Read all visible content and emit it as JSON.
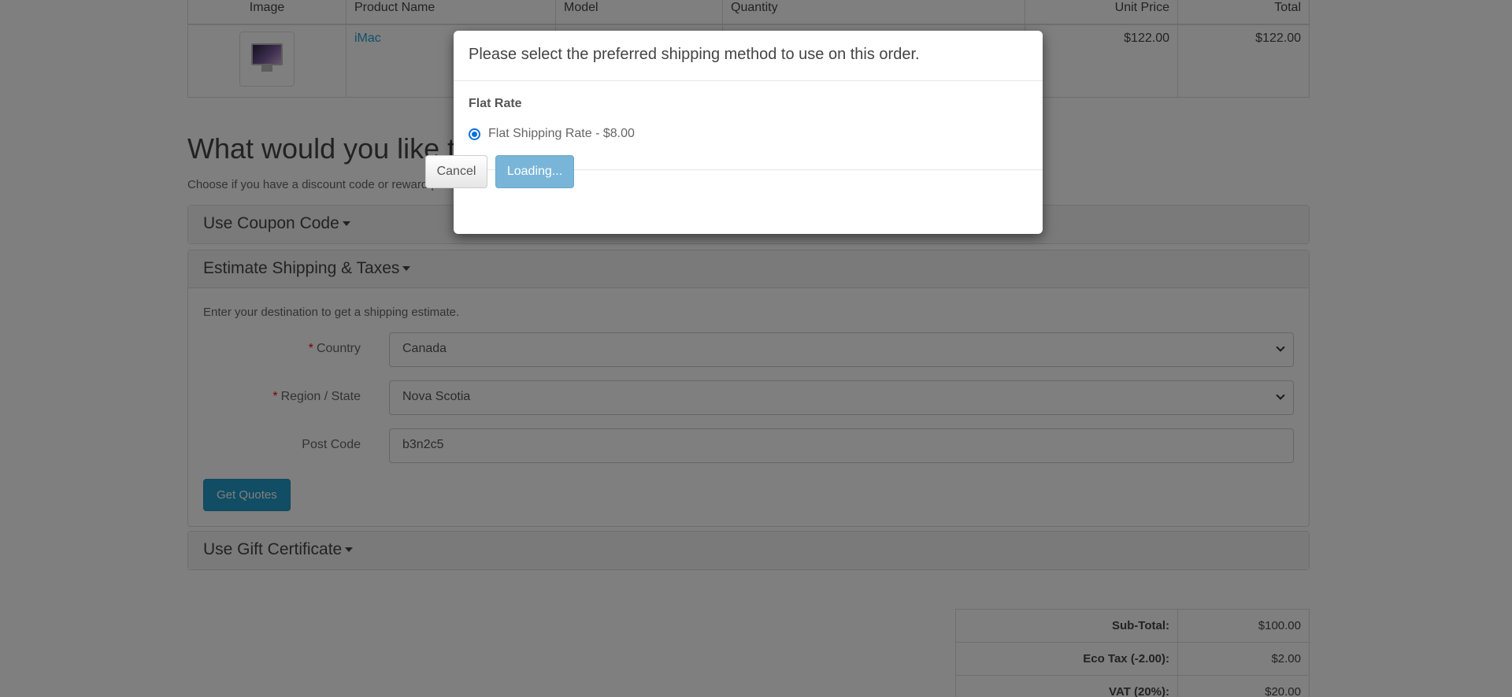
{
  "cart": {
    "headers": [
      "Image",
      "Product Name",
      "Model",
      "Quantity",
      "Unit Price",
      "Total"
    ],
    "rows": [
      {
        "image_icon": "imac-thumbnail",
        "name": "iMac",
        "model": "",
        "quantity": "",
        "unit_price": "$122.00",
        "total": "$122.00"
      }
    ]
  },
  "next": {
    "title": "What would you like t",
    "subtitle": "Choose if you have a discount code or reward po"
  },
  "coupon": {
    "title": "Use Coupon Code"
  },
  "shipping": {
    "title": "Estimate Shipping & Taxes",
    "intro": "Enter your destination to get a shipping estimate.",
    "country_label": "Country",
    "country_value": "Canada",
    "region_label": "Region / State",
    "region_value": "Nova Scotia",
    "postcode_label": "Post Code",
    "postcode_value": "b3n2c5",
    "required_mark": "*",
    "quote_button": "Get Quotes"
  },
  "gift": {
    "title": "Use Gift Certificate"
  },
  "totals": [
    {
      "label": "Sub-Total:",
      "value": "$100.00"
    },
    {
      "label": "Eco Tax (-2.00):",
      "value": "$2.00"
    },
    {
      "label": "VAT (20%):",
      "value": "$20.00"
    }
  ],
  "modal": {
    "title": "Please select the preferred shipping method to use on this order.",
    "group": "Flat Rate",
    "option": "Flat Shipping Rate - $8.00",
    "option_selected": true,
    "cancel": "Cancel",
    "confirm": "Loading..."
  },
  "colors": {
    "accent": "#229ac8",
    "link": "#23a1d1",
    "required": "#ff0000",
    "radio": "#0b6fe0",
    "loading_button": "#79b5d8"
  }
}
